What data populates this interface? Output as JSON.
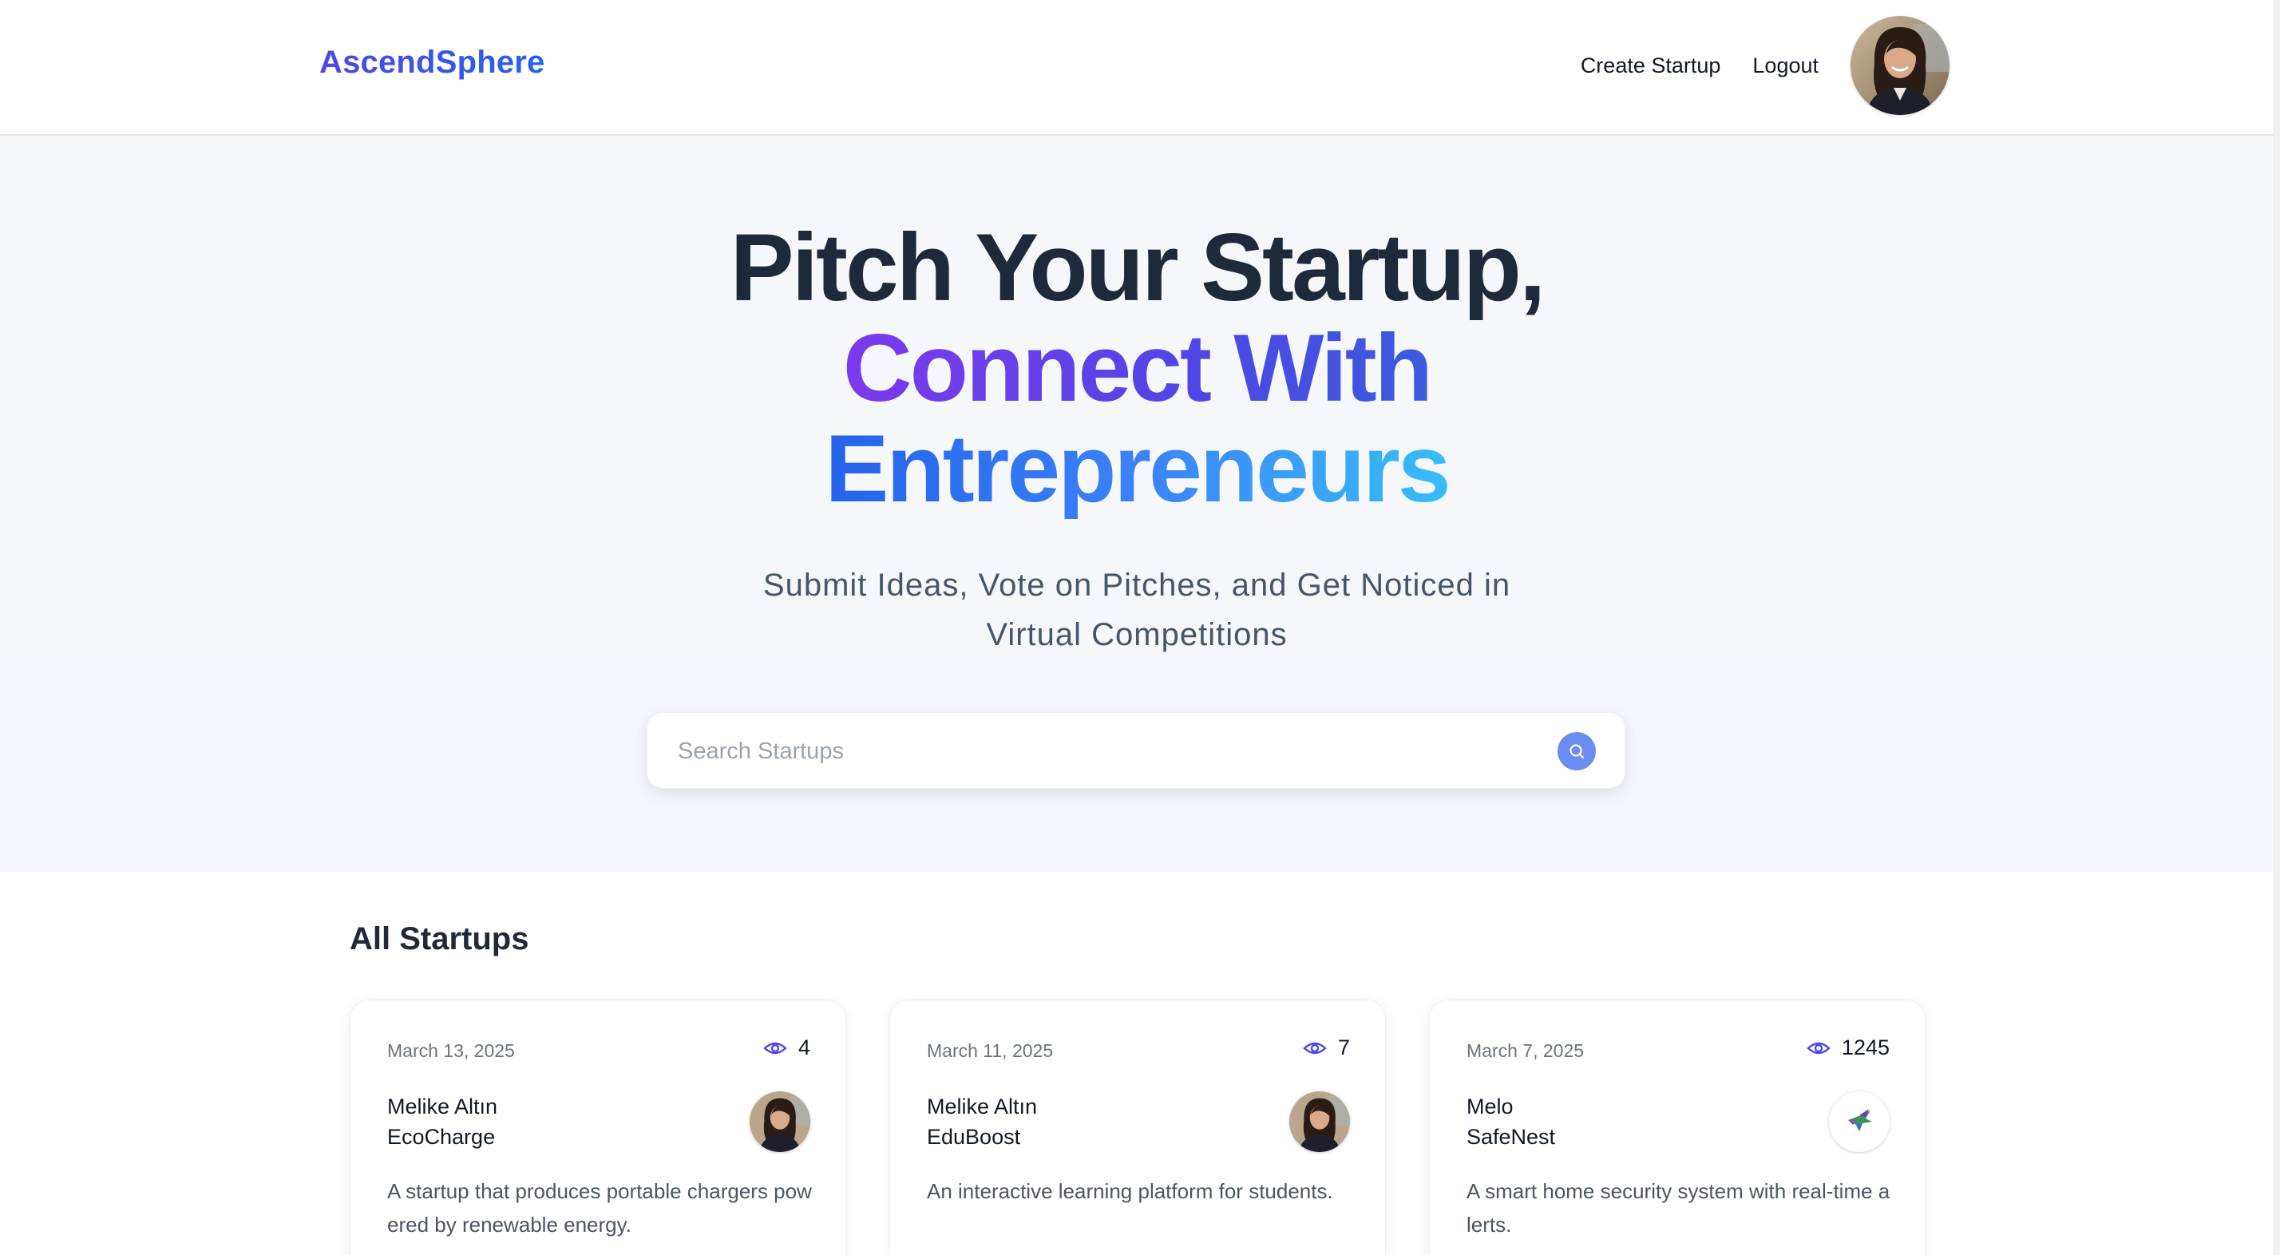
{
  "header": {
    "logo": "AscendSphere",
    "nav": {
      "create_startup": "Create Startup",
      "logout": "Logout"
    }
  },
  "hero": {
    "line1": "Pitch Your Startup,",
    "line2": "Connect With",
    "line3": "Entrepreneurs",
    "subtitle": "Submit Ideas, Vote on Pitches, and Get Noticed in Virtual Competitions",
    "search_placeholder": "Search Startups",
    "search_value": ""
  },
  "section": {
    "title": "All Startups"
  },
  "cards": [
    {
      "date": "March 13, 2025",
      "views": "4",
      "author": "Melike Altın",
      "name": "EcoCharge",
      "description": "A startup that produces portable chargers powered by renewable energy.",
      "avatar_icon": "user-photo-icon"
    },
    {
      "date": "March 11, 2025",
      "views": "7",
      "author": "Melike Altın",
      "name": "EduBoost",
      "description": "An interactive learning platform for students.",
      "avatar_icon": "user-photo-icon"
    },
    {
      "date": "March 7, 2025",
      "views": "1245",
      "author": "Melo",
      "name": "SafeNest",
      "description": "A smart home security system with real-time alerts.",
      "avatar_icon": "bird-logo-icon"
    }
  ],
  "colors": {
    "brand": "#4f46e5",
    "accent_blue": "#2563eb",
    "search_button": "#6b8cf0",
    "eye_icon": "#4f46e5"
  }
}
